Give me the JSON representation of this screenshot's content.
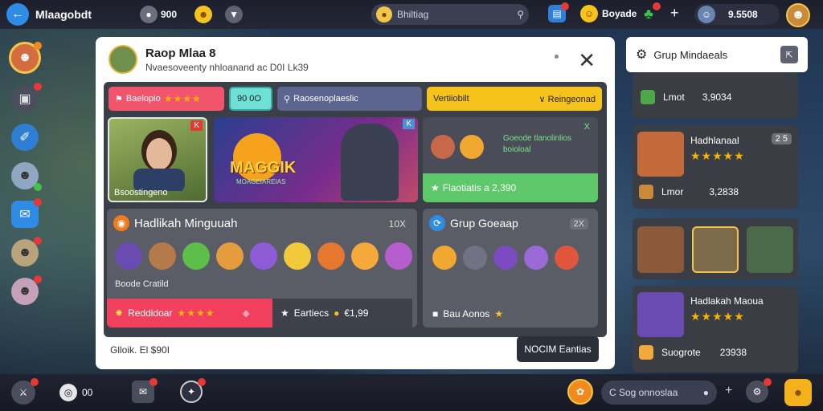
{
  "topbar": {
    "app_title": "Mlaagobdt",
    "coins": "900",
    "search_placeholder": "Bhiltiag",
    "boosts_label": "Boyade",
    "gold": "9.5508"
  },
  "main_panel": {
    "title": "Raop Mlaa 8",
    "subtitle": "Nvaesoveenty nhloanand ac D0I Lk39",
    "filters": {
      "chip1": "Baelopio",
      "chip2": "90 0O",
      "chip3": "Raosenoplaeslic",
      "chip4": "Vertiiobilt",
      "chip5": "Reingeonad"
    },
    "featured_card": {
      "caption": "Bsoostingeno",
      "corner_badge": "K"
    },
    "magic_card": {
      "title": "MAGGIK",
      "subtitle": "MOAGEIAREIAS",
      "corner_badge": "K"
    },
    "offer_card": {
      "text_line1": "Goeode tlanolinlios",
      "text_line2": "boioloal",
      "footer": "Flaotiatis a 2,390",
      "close": "X"
    },
    "collection_card": {
      "title": "Hadlikah Minguuah",
      "count": "10X",
      "label": "Boode Cratild",
      "bottom_left": "Reddidoar",
      "bottom_right": "Eartiecs",
      "bottom_right_value": "€1,99"
    },
    "group_card": {
      "title": "Grup Goeaap",
      "count": "2X",
      "footer": "Bau Aonos"
    },
    "footer_left": "Glloik. El $90I",
    "footer_button": "NOCIM Eantias"
  },
  "right_panel": {
    "title": "Grup Mindaeals",
    "row1_name": "Lmot",
    "row1_value": "3,9034",
    "card2_title": "Hadhlanaal",
    "card2_count": "2 5",
    "card2_name": "Lmor",
    "card2_value": "3,2838",
    "card4_title": "Hadlakah Maoua",
    "card4_name": "Suogrote",
    "card4_value": "23938"
  },
  "bottombar": {
    "counter": "00",
    "search_placeholder": "C Sog onnoslaa"
  }
}
